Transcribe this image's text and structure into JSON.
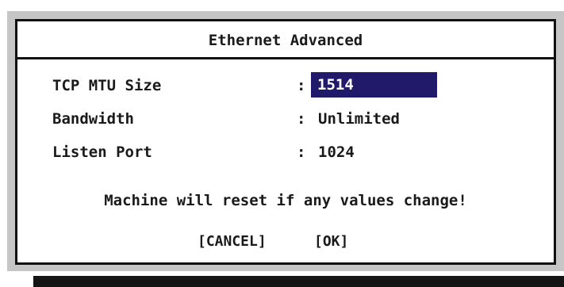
{
  "dialog": {
    "title": "Ethernet Advanced",
    "fields": [
      {
        "label": "TCP MTU Size",
        "separator": ":",
        "value": "1514",
        "selected": true
      },
      {
        "label": "Bandwidth",
        "separator": ":",
        "value": "Unlimited",
        "selected": false
      },
      {
        "label": "Listen Port",
        "separator": ":",
        "value": "1024",
        "selected": false
      }
    ],
    "warning": "Machine will reset if any values change!",
    "buttons": {
      "cancel": "[CANCEL]",
      "ok": "[OK]"
    }
  },
  "colors": {
    "selection_bg": "#211a6b",
    "selection_fg": "#ffffff",
    "backdrop": "#c6c6c6",
    "border": "#111111"
  }
}
